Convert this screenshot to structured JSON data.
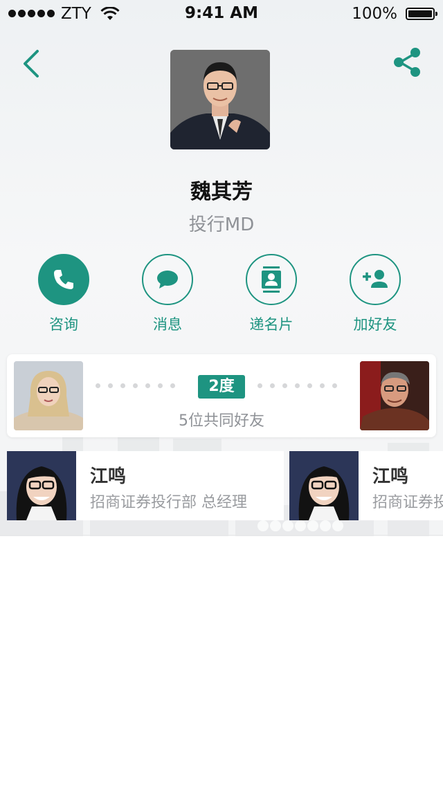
{
  "status_bar": {
    "carrier": "ZTY",
    "time": "9:41 AM",
    "battery": "100%"
  },
  "profile": {
    "name": "魏其芳",
    "title": "投行MD"
  },
  "actions": [
    {
      "label": "咨询",
      "icon": "phone-icon",
      "filled": true
    },
    {
      "label": "消息",
      "icon": "chat-bubble-icon",
      "filled": false
    },
    {
      "label": "递名片",
      "icon": "contact-card-icon",
      "filled": false
    },
    {
      "label": "加好友",
      "icon": "add-friend-icon",
      "filled": false
    }
  ],
  "connection": {
    "degree": "2度",
    "mutual_text": "5位共同好友"
  },
  "mutual_friends": [
    {
      "name": "江鸣",
      "role": "招商证券投行部 总经理"
    },
    {
      "name": "江鸣",
      "role": "招商证券投行部 总经理"
    }
  ],
  "colors": {
    "accent": "#1e9481",
    "secondary_text": "#8f9297"
  }
}
